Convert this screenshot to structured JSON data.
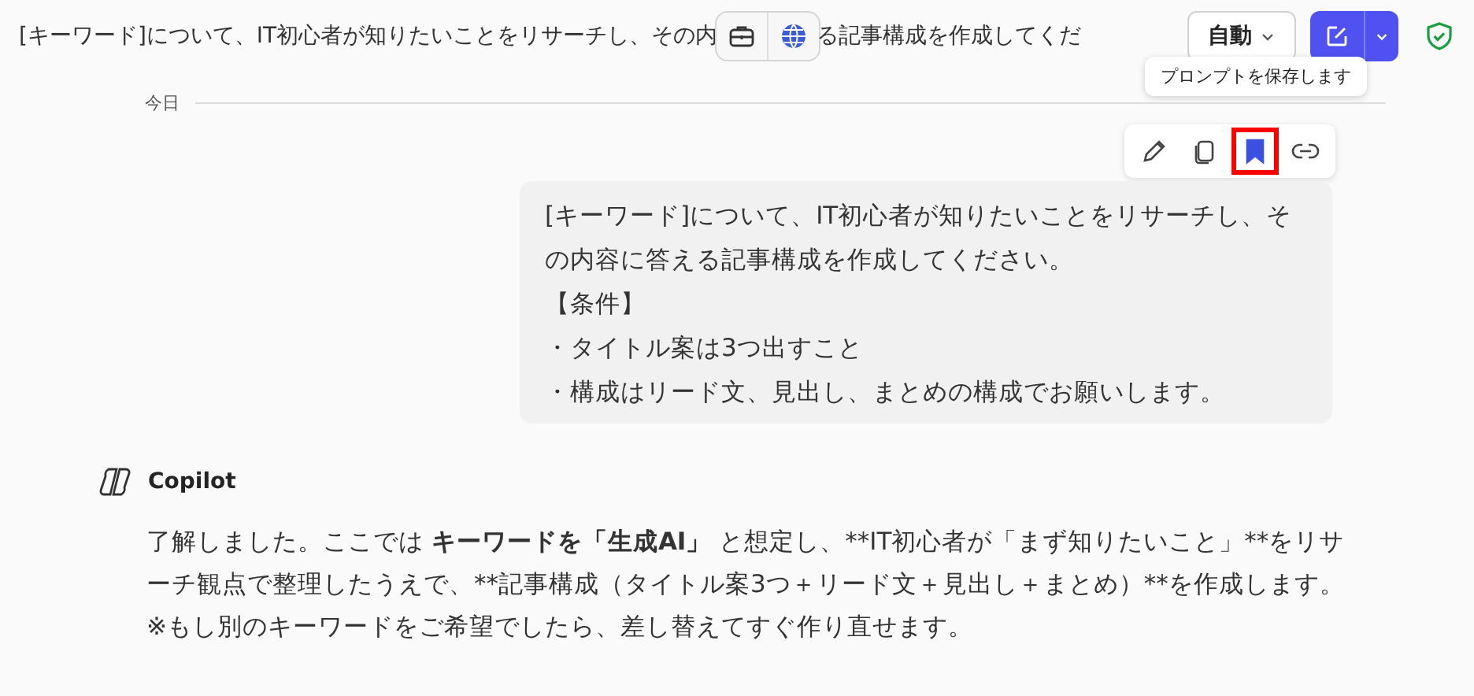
{
  "header": {
    "title_parts": [
      "[キーワード]について、IT初心者が知りたいことをリサーチし、その内",
      "る記事構成を作成してくだ"
    ],
    "mode_button": "自動"
  },
  "tooltip": "プロンプトを保存します",
  "date_label": "今日",
  "message_actions": [
    {
      "kind": "edit",
      "selected": false
    },
    {
      "kind": "copy",
      "selected": false
    },
    {
      "kind": "bookmark",
      "selected": true
    },
    {
      "kind": "link",
      "selected": false
    }
  ],
  "user_message": [
    "[キーワード]について、IT初心者が知りたいことをリサーチし、その内容に答える記事構成を作成してください。",
    "【条件】",
    "・タイトル案は3つ出すこと",
    "・構成はリード文、見出し、まとめの構成でお願いします。"
  ],
  "assistant": {
    "name": "Copilot",
    "paragraph": [
      {
        "text": "了解しました。ここでは ",
        "bold": false
      },
      {
        "text": "キーワードを「生成AI」",
        "bold": true
      },
      {
        "text": " と想定し、**IT初心者が「まず知りたいこと」**をリサーチ観点で整理したうえで、**記事構成（タイトル案3つ＋リード文＋見出し＋まとめ）**を作成します。",
        "bold": false
      }
    ],
    "note": "※もし別のキーワードをご希望でしたら、差し替えてすぐ作り直せます。"
  }
}
